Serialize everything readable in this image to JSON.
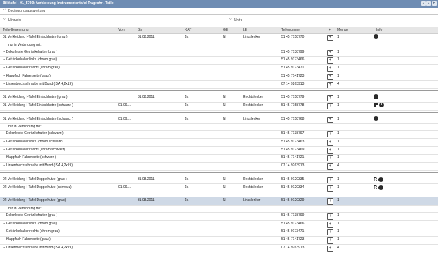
{
  "window": {
    "title": "Bildtafel - 01_5760: Verkleidung Instrumententafel Tragrohr - Teile",
    "buttons": [
      "◂",
      "▸",
      "✕"
    ]
  },
  "sections": {
    "bedingung": "Bedingungsauswertung",
    "hinweis": "Hinweis",
    "notiz": "Notiz"
  },
  "columns": {
    "teil": "Teile-Benennung",
    "von": "Von",
    "bis": "Bis",
    "kat": "KAT",
    "ge": "GE",
    "le": "LE",
    "nr": "Teilenummer",
    "plus": "+",
    "menge": "Menge",
    "info": "Info"
  },
  "rows": [
    {
      "teil": "01 Verkleidung I-Tafel Einfachhutze (grau )",
      "von": "",
      "bis": "31.08.2011",
      "kat": "Ja",
      "ge": "N",
      "le": "Linkslenker",
      "nr": "51 45 7158770",
      "plus": "+",
      "menge": "1",
      "icons": [
        "info"
      ]
    },
    {
      "teil": "nur in Verbindung mit:",
      "note": true
    },
    {
      "teil": "-- Dekorleiste Getränkehalter (grau )",
      "nr": "51 45 7138799",
      "plus": "+",
      "menge": "1"
    },
    {
      "teil": "-- Getränkehalter links (chrom grau)",
      "nr": "51 45 9173466",
      "plus": "+",
      "menge": "1"
    },
    {
      "teil": "-- Getränkehalter rechts (chrom grau)",
      "nr": "51 45 9173471",
      "plus": "+",
      "menge": "1"
    },
    {
      "teil": "-- Klappfach Fahrerseite (grau )",
      "nr": "51 45 7141723",
      "plus": "+",
      "menge": "1"
    },
    {
      "teil": "-- Linsenblechschraube mit Bund (ISA 4,2x19)",
      "nr": "07 14 9263913",
      "plus": "+",
      "menge": "4"
    },
    {
      "gap": true
    },
    {
      "teil": "01 Verkleidung I-Tafel Einfachhutze (grau )",
      "von": "",
      "bis": "31.08.2011",
      "kat": "Ja",
      "ge": "N",
      "le": "Rechtslenker",
      "nr": "51 45 7158779",
      "plus": "+",
      "menge": "1",
      "icons": [
        "info"
      ]
    },
    {
      "teil": "01 Verkleidung I-Tafel Einfachhutze (schwarz )",
      "von": "01.09....",
      "bis": "",
      "kat": "Ja",
      "ge": "N",
      "le": "Rechtslenker",
      "nr": "51 45 7158778",
      "plus": "+",
      "menge": "1",
      "icons": [
        "note",
        "info"
      ]
    },
    {
      "gap": true
    },
    {
      "teil": "01 Verkleidung I-Tafel Einfachhutze (schwarz )",
      "von": "01.09....",
      "bis": "",
      "kat": "Ja",
      "ge": "N",
      "le": "Linkslenker",
      "nr": "51 45 7158768",
      "plus": "+",
      "menge": "1",
      "icons": [
        "info"
      ]
    },
    {
      "teil": "nur in Verbindung mit:",
      "note": true
    },
    {
      "teil": "-- Dekorleiste Getränkehalter (schwarz )",
      "nr": "51 45 7138797",
      "plus": "+",
      "menge": "1"
    },
    {
      "teil": "-- Getränkehalter links (chrom schwarz)",
      "nr": "51 45 9173463",
      "plus": "+",
      "menge": "1"
    },
    {
      "teil": "-- Getränkehalter rechts (chrom schwarz)",
      "nr": "51 45 9173469",
      "plus": "+",
      "menge": "1"
    },
    {
      "teil": "-- Klappfach Fahrerseite (schwarz )",
      "nr": "51 45 7141721",
      "plus": "+",
      "menge": "1"
    },
    {
      "teil": "-- Linsenblechschraube mit Bund (ISA 4,2x19)",
      "nr": "07 14 9263913",
      "plus": "+",
      "menge": "4"
    },
    {
      "gap": true
    },
    {
      "teil": "02 Verkleidung I-Tafel Doppelhutze (grau )",
      "von": "",
      "bis": "31.08.2011",
      "kat": "Ja",
      "ge": "N",
      "le": "Rechtslenker",
      "nr": "51 45 9120335",
      "plus": "+",
      "menge": "1",
      "icons": [
        "r",
        "info"
      ]
    },
    {
      "teil": "02 Verkleidung I-Tafel Doppelhutze (schwarz)",
      "von": "01.09....",
      "bis": "",
      "kat": "Ja",
      "ge": "N",
      "le": "Rechtslenker",
      "nr": "51 45 9120334",
      "plus": "+",
      "menge": "1",
      "icons": [
        "r",
        "info"
      ]
    },
    {
      "gap": true
    },
    {
      "teil": "02 Verkleidung I-Tafel Doppelhutze (grau)",
      "von": "",
      "bis": "31.08.2011",
      "kat": "Ja",
      "ge": "N",
      "le": "Linkslenker",
      "nr": "51 45 9120329",
      "plus": "+",
      "menge": "1",
      "selected": true
    },
    {
      "teil": "nur in Verbindung mit:",
      "note": true
    },
    {
      "teil": "-- Dekorleiste Getränkehalter (grau )",
      "nr": "51 45 7138799",
      "plus": "+",
      "menge": "1"
    },
    {
      "teil": "-- Getränkehalter links (chrom grau)",
      "nr": "51 45 9173466",
      "plus": "+",
      "menge": "1"
    },
    {
      "teil": "-- Getränkehalter rechts (chrom grau)",
      "nr": "51 45 9173471",
      "plus": "+",
      "menge": "1"
    },
    {
      "teil": "-- Klappfach Fahrerseite (grau )",
      "nr": "51 45 7141723",
      "plus": "+",
      "menge": "1"
    },
    {
      "teil": "-- Linsenblechschraube mit Bund (ISA 4,2x19)",
      "nr": "07 14 9263913",
      "plus": "+",
      "menge": "4"
    }
  ],
  "colors": {
    "titlebar": "#6e8cb3",
    "selected_row": "#cfd9e6",
    "header_bg": "#e6e6e6"
  }
}
